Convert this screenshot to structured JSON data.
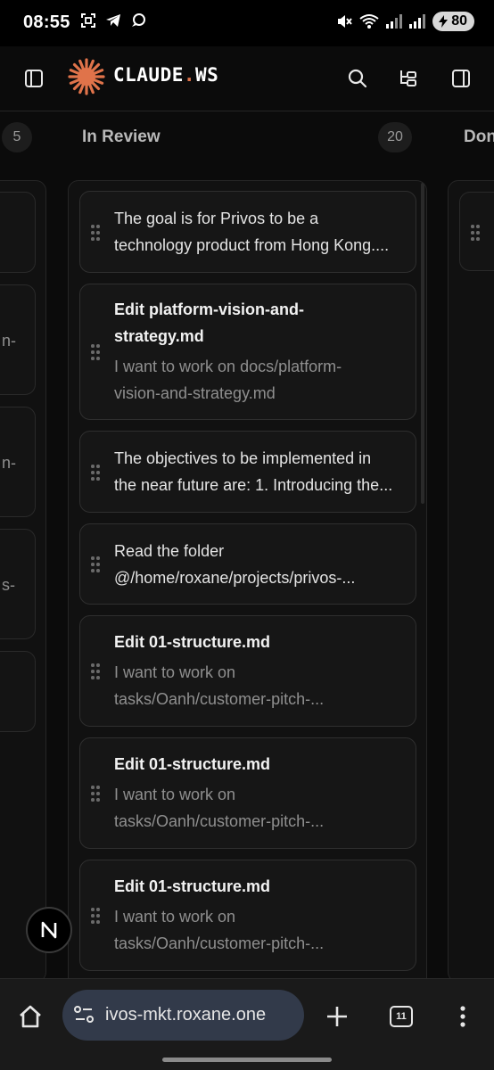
{
  "status_bar": {
    "time": "08:55",
    "battery": "80"
  },
  "header": {
    "brand_main": "CLAUDE",
    "brand_dot": ".",
    "brand_suffix": "WS",
    "accent_color": "#e0734a"
  },
  "board": {
    "left_column_count": "5",
    "review_column": {
      "title": "In Review",
      "count": "20"
    },
    "next_column_title": "Don",
    "cards": [
      {
        "text": [
          "The goal is for Privos to be a",
          "technology product from Hong Kong...."
        ]
      },
      {
        "title": [
          "Edit platform-vision-and-",
          "strategy.md"
        ],
        "description": [
          "I want to work on docs/platform-",
          "vision-and-strategy.md"
        ]
      },
      {
        "text": [
          "The objectives to be implemented in",
          "the near future are: 1. Introducing the..."
        ]
      },
      {
        "text": [
          "Read the folder",
          "@/home/roxane/projects/privos-..."
        ]
      },
      {
        "title": [
          "Edit 01-structure.md"
        ],
        "description": [
          "I want to work on",
          "tasks/Oanh/customer-pitch-..."
        ]
      },
      {
        "title": [
          "Edit 01-structure.md"
        ],
        "description": [
          "I want to work on",
          "tasks/Oanh/customer-pitch-..."
        ]
      },
      {
        "title": [
          "Edit 01-structure.md"
        ],
        "description": [
          "I want to work on",
          "tasks/Oanh/customer-pitch-..."
        ]
      }
    ],
    "left_fragments": [
      "n-",
      "n-",
      "s-"
    ]
  },
  "fab_label": "N",
  "browser": {
    "url": "ivos-mkt.roxane.one",
    "tab_count": "11"
  }
}
